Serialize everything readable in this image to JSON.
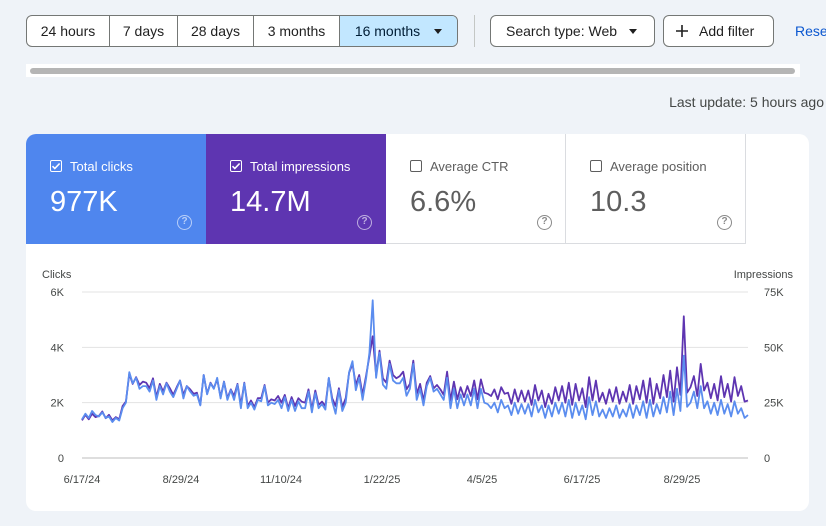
{
  "toolbar": {
    "ranges": [
      "24 hours",
      "7 days",
      "28 days",
      "3 months",
      "16 months"
    ],
    "search_type": "Search type: Web",
    "add_filter": "Add filter",
    "reset": "Rese"
  },
  "last_update": "Last update: 5 hours ago",
  "metrics": [
    {
      "label": "Total clicks",
      "value": "977K",
      "checked": true,
      "color": "#4f86ee"
    },
    {
      "label": "Total impressions",
      "value": "14.7M",
      "checked": true,
      "color": "#5e35b1"
    },
    {
      "label": "Average CTR",
      "value": "6.6%",
      "checked": false,
      "color": "#ffffff"
    },
    {
      "label": "Average position",
      "value": "10.3",
      "checked": false,
      "color": "#ffffff"
    }
  ],
  "chart_data": {
    "type": "line",
    "left_axis": {
      "label": "Clicks",
      "ticks": [
        "0",
        "2K",
        "4K",
        "6K"
      ],
      "range": [
        0,
        6000
      ]
    },
    "right_axis": {
      "label": "Impressions",
      "ticks": [
        "0",
        "25K",
        "50K",
        "75K"
      ],
      "range": [
        0,
        75000
      ]
    },
    "x_ticks": [
      "6/17/24",
      "8/29/24",
      "11/10/24",
      "1/22/25",
      "4/5/25",
      "6/17/25",
      "8/29/25"
    ],
    "grid": true,
    "series": [
      {
        "axis": "right",
        "color": "#5e35b1",
        "values": [
          17000,
          19500,
          17500,
          20000,
          18500,
          19000,
          21000,
          18000,
          19500,
          17000,
          18500,
          17500,
          23500,
          25500,
          38000,
          33500,
          36500,
          33000,
          34500,
          34000,
          31500,
          36000,
          27500,
          33500,
          30000,
          34000,
          31500,
          28500,
          32000,
          35000,
          28500,
          32500,
          31000,
          29000,
          29500,
          24000,
          37500,
          29000,
          34000,
          31500,
          35500,
          27500,
          34500,
          27000,
          31000,
          28000,
          33500,
          24000,
          34000,
          23500,
          26000,
          23000,
          27000,
          27000,
          33000,
          25000,
          26500,
          26000,
          28000,
          25000,
          28500,
          22500,
          27500,
          23500,
          27000,
          25500,
          25000,
          31000,
          22000,
          30500,
          24000,
          25500,
          23500,
          36000,
          27000,
          23500,
          31500,
          23000,
          27000,
          38500,
          42500,
          33000,
          37500,
          28500,
          37000,
          46000,
          55000,
          37500,
          48500,
          36000,
          34000,
          44000,
          37500,
          36000,
          37000,
          39000,
          31000,
          33500,
          44000,
          29000,
          33500,
          26000,
          34000,
          37000,
          31500,
          33000,
          31000,
          28500,
          39000,
          26000,
          34500,
          26500,
          32000,
          27500,
          32500,
          28000,
          35000,
          26500,
          35500,
          29500,
          29000,
          28000,
          31000,
          26500,
          32000,
          29000,
          29500,
          24500,
          31000,
          25500,
          30500,
          25500,
          30500,
          24000,
          33000,
          26000,
          30500,
          23000,
          29000,
          24500,
          32000,
          26000,
          32500,
          25000,
          34000,
          24000,
          33500,
          26000,
          31500,
          23000,
          36500,
          26000,
          35000,
          25500,
          29500,
          24500,
          31000,
          25500,
          32000,
          24500,
          30000,
          25500,
          33000,
          24500,
          32500,
          26500,
          35000,
          25000,
          36000,
          24500,
          33500,
          27000,
          37500,
          27500,
          39500,
          25500,
          41000,
          28500,
          64000,
          29500,
          32000,
          37000,
          28000,
          42500,
          30500,
          34000,
          27000,
          33500,
          26000,
          37000,
          27500,
          33500,
          25500,
          36500,
          28000,
          32500,
          25500,
          26000
        ]
      },
      {
        "axis": "left",
        "color": "#5b8def",
        "values": [
          1400,
          1600,
          1450,
          1700,
          1550,
          1500,
          1650,
          1450,
          1500,
          1300,
          1450,
          1350,
          1800,
          2000,
          3100,
          2700,
          2900,
          2500,
          2600,
          2600,
          2400,
          2800,
          2100,
          2600,
          2300,
          2700,
          2400,
          2200,
          2500,
          2800,
          2150,
          2600,
          2400,
          2250,
          2300,
          1900,
          3000,
          2300,
          2700,
          2500,
          2900,
          2150,
          2750,
          2100,
          2450,
          2100,
          2650,
          1800,
          2700,
          1800,
          2000,
          1750,
          2100,
          2050,
          2600,
          1900,
          2000,
          1950,
          2100,
          1800,
          2200,
          1700,
          2100,
          1700,
          2050,
          1800,
          1800,
          2400,
          1650,
          2350,
          1800,
          1950,
          1750,
          2900,
          2050,
          1600,
          2450,
          1700,
          2000,
          3100,
          3500,
          2450,
          2900,
          2100,
          2850,
          3800,
          5700,
          2900,
          3800,
          2650,
          2500,
          3400,
          2800,
          2700,
          2700,
          2900,
          2250,
          2500,
          3400,
          2100,
          2500,
          1900,
          2600,
          2900,
          2400,
          2500,
          2300,
          2100,
          2900,
          1800,
          2500,
          1800,
          2300,
          1900,
          2300,
          1900,
          2500,
          1800,
          2500,
          2000,
          1950,
          1800,
          2000,
          1650,
          2100,
          1800,
          1900,
          1550,
          2000,
          1600,
          1950,
          1600,
          1950,
          1500,
          2100,
          1650,
          1900,
          1450,
          1900,
          1500,
          2000,
          1600,
          2000,
          1500,
          2100,
          1450,
          2000,
          1550,
          1900,
          1400,
          2200,
          1550,
          2050,
          1500,
          1750,
          1450,
          1800,
          1500,
          1900,
          1450,
          1750,
          1500,
          1950,
          1450,
          1900,
          1550,
          2050,
          1450,
          2100,
          1500,
          1950,
          1600,
          2200,
          1650,
          2400,
          1550,
          2500,
          1700,
          3700,
          1850,
          2000,
          2400,
          1800,
          2600,
          1800,
          2050,
          1600,
          2000,
          1550,
          2100,
          1600,
          1950,
          1500,
          2050,
          1600,
          1800,
          1450,
          1550
        ]
      }
    ]
  }
}
